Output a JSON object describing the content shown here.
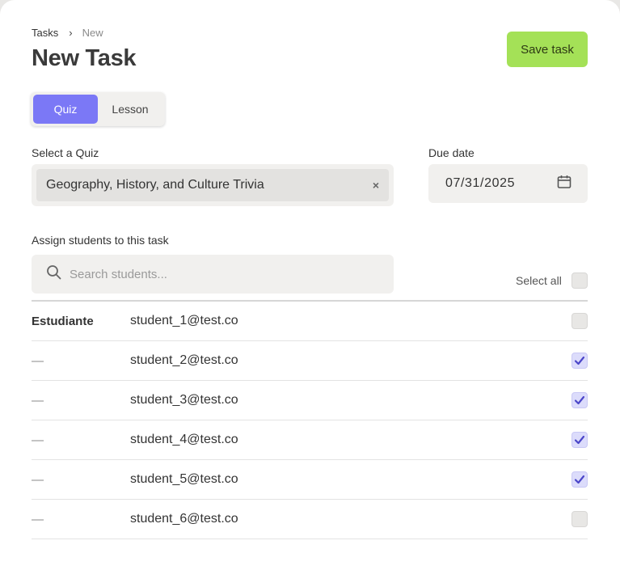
{
  "breadcrumb": {
    "items": [
      "Tasks",
      "New"
    ],
    "separator": "›"
  },
  "page": {
    "title": "New Task"
  },
  "actions": {
    "save_label": "Save task"
  },
  "type_toggle": {
    "options": [
      "Quiz",
      "Lesson"
    ],
    "selected": "Quiz"
  },
  "quiz": {
    "label": "Select a Quiz",
    "value": "Geography, History, and Culture Trivia",
    "clear_icon": "×"
  },
  "due_date": {
    "label": "Due date",
    "value": "07/31/2025",
    "icon": "calendar-icon"
  },
  "students": {
    "label": "Assign students to this task",
    "search_placeholder": "Search students...",
    "select_all_label": "Select all",
    "rows": [
      {
        "name": "Estudiante",
        "email": "student_1@test.co",
        "checked": false
      },
      {
        "name": "—",
        "email": "student_2@test.co",
        "checked": true
      },
      {
        "name": "—",
        "email": "student_3@test.co",
        "checked": true
      },
      {
        "name": "—",
        "email": "student_4@test.co",
        "checked": true
      },
      {
        "name": "—",
        "email": "student_5@test.co",
        "checked": true
      },
      {
        "name": "—",
        "email": "student_6@test.co",
        "checked": false
      }
    ]
  },
  "colors": {
    "accent": "#7b78f6",
    "save": "#a4e157",
    "check_on": "#dcdcfb"
  }
}
